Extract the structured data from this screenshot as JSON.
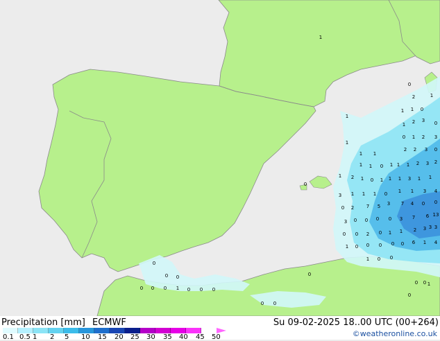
{
  "title": {
    "product": "Precipitation [mm]",
    "model": "ECMWF",
    "datetime": "Su 09-02-2025 18..00 UTC (00+264)"
  },
  "credit": "©weatheronline.co.uk",
  "legend": {
    "ticks": [
      "0.1",
      "0.5",
      "1",
      "2",
      "5",
      "10",
      "15",
      "20",
      "25",
      "30",
      "35",
      "40",
      "45",
      "50"
    ],
    "colors": [
      "#e0fbff",
      "#b4f0ff",
      "#8ce4f6",
      "#64d2f0",
      "#3cbcea",
      "#2896dc",
      "#1e6ecc",
      "#1a46b4",
      "#0a1e8c",
      "#b400c8",
      "#d200d2",
      "#e600e6",
      "#fa32fa",
      "#ff66ff"
    ]
  },
  "colors": {
    "land": "#b7f08c",
    "sea": "#ececec",
    "border": "#8a8a8a",
    "rain_light": "#d2f7fa",
    "rain_mid": "#8ee4f4",
    "rain_heavy": "#4fb9ea",
    "rain_max": "#3a8fdc"
  },
  "precip_values": [
    "0",
    "1",
    "0",
    "2",
    "1",
    "1",
    "3",
    "2",
    "1",
    "0",
    "1",
    "0",
    "1",
    "2",
    "3",
    "2",
    "3",
    "1",
    "1",
    "1",
    "2",
    "0",
    "1",
    "1",
    "0",
    "1",
    "1",
    "1",
    "2",
    "3",
    "2",
    "1",
    "2",
    "1",
    "0",
    "1",
    "1",
    "1",
    "3",
    "1",
    "1",
    "1",
    "1",
    "1",
    "0",
    "1",
    "1",
    "3",
    "3",
    "4",
    "3",
    "7",
    "4",
    "0",
    "0",
    "0",
    "2",
    "7",
    "5",
    "6",
    "13",
    "0",
    "0",
    "0",
    "0",
    "3",
    "7",
    "3",
    "3",
    "3",
    "0",
    "0",
    "2",
    "0",
    "1",
    "1",
    "2",
    "3",
    "6",
    "1",
    "4",
    "1",
    "0",
    "0",
    "0",
    "0",
    "0",
    "1",
    "0",
    "0",
    "0",
    "1",
    "0",
    "0",
    "0",
    "0",
    "0",
    "0",
    "0",
    "0",
    "1",
    "0",
    "0",
    "0",
    "0",
    "1",
    "0",
    "0",
    "0"
  ]
}
